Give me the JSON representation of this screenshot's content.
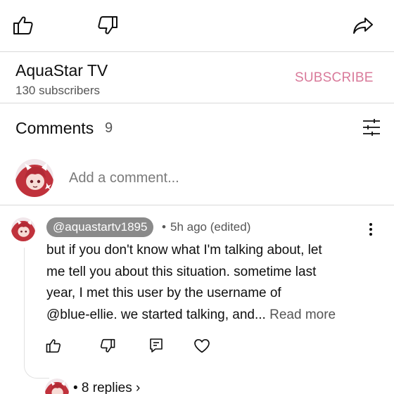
{
  "actions": {
    "like_icon": "thumbs-up-icon",
    "dislike_icon": "thumbs-down-icon",
    "share_icon": "share-icon"
  },
  "channel": {
    "name": "AquaStar TV",
    "subscribers": "130 subscribers",
    "subscribe_label": "SUBSCRIBE"
  },
  "comments": {
    "title": "Comments",
    "count": "9",
    "sort_icon": "filter-sliders-icon",
    "add_placeholder": "Add a comment..."
  },
  "comment": {
    "author": "@aquastartv1895",
    "separator": "•",
    "time": "5h ago (edited)",
    "lines": [
      "but if you don't know what I'm talking about, let",
      "me tell you about this situation. sometime last",
      "year, I met this user by the username of",
      "@blue-ellie. we started talking, and..."
    ],
    "read_more": "Read more",
    "replies": "• 8 replies ›",
    "action_icons": [
      "thumbs-up-icon",
      "thumbs-down-icon",
      "reply-icon",
      "heart-icon"
    ],
    "menu_icon": "more-vert-icon"
  },
  "colors": {
    "subscribe": "#d97a9a",
    "secondary_text": "#555555",
    "author_chip": "#8a8a8a",
    "divider": "#d9d9d9"
  }
}
